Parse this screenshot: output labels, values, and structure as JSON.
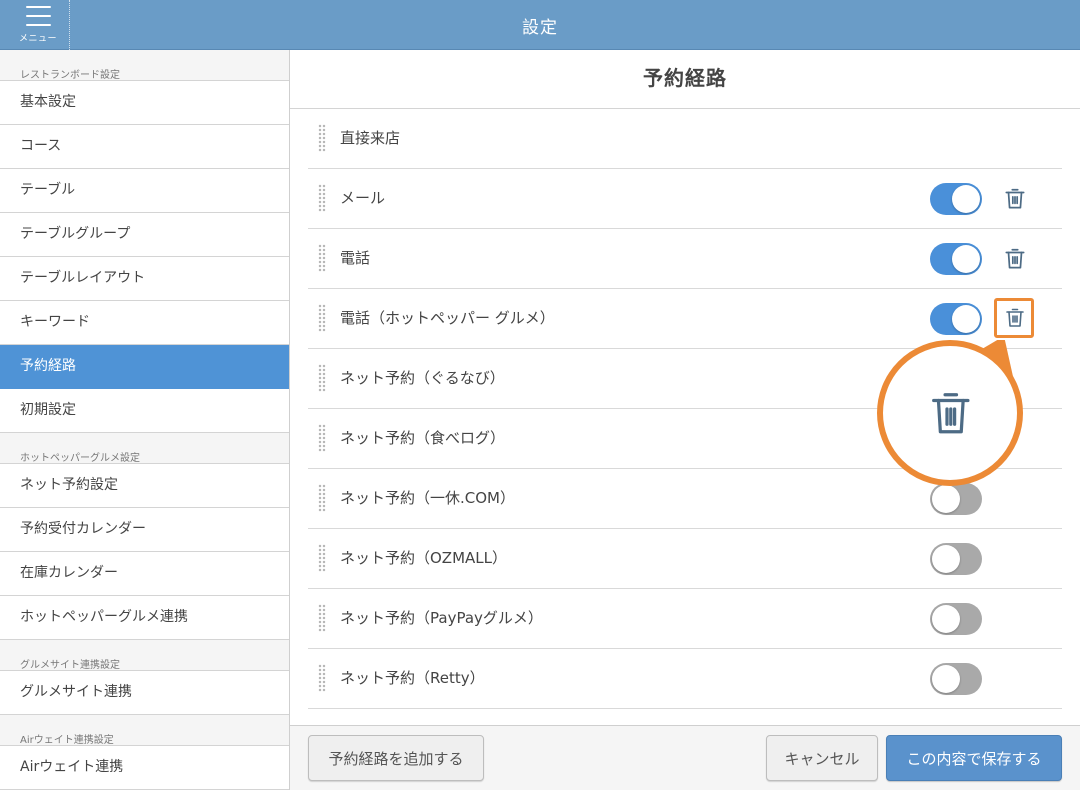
{
  "header": {
    "menu_label": "メニュー",
    "title": "設定"
  },
  "sidebar": {
    "sections": [
      {
        "title": "レストランボード設定",
        "items": [
          "基本設定",
          "コース",
          "テーブル",
          "テーブルグループ",
          "テーブルレイアウト",
          "キーワード",
          "予約経路",
          "初期設定"
        ]
      },
      {
        "title": "ホットペッパーグルメ設定",
        "items": [
          "ネット予約設定",
          "予約受付カレンダー",
          "在庫カレンダー",
          "ホットペッパーグルメ連携"
        ]
      },
      {
        "title": "グルメサイト連携設定",
        "items": [
          "グルメサイト連携"
        ]
      },
      {
        "title": "Airウェイト連携設定",
        "items": [
          "Airウェイト連携"
        ]
      }
    ],
    "active_item": "予約経路"
  },
  "main": {
    "title": "予約経路",
    "rows": [
      {
        "label": "直接来店",
        "toggle": null,
        "deletable": false
      },
      {
        "label": "メール",
        "toggle": true,
        "deletable": true
      },
      {
        "label": "電話",
        "toggle": true,
        "deletable": true
      },
      {
        "label": "電話（ホットペッパー グルメ）",
        "toggle": true,
        "deletable": true,
        "highlighted": true
      },
      {
        "label": "ネット予約（ぐるなび）",
        "toggle": null,
        "deletable": false
      },
      {
        "label": "ネット予約（食べログ）",
        "toggle": null,
        "deletable": false
      },
      {
        "label": "ネット予約（一休.COM）",
        "toggle": false,
        "deletable": false
      },
      {
        "label": "ネット予約（OZMALL）",
        "toggle": false,
        "deletable": false
      },
      {
        "label": "ネット予約（PayPayグルメ）",
        "toggle": false,
        "deletable": false
      },
      {
        "label": "ネット予約（Retty）",
        "toggle": false,
        "deletable": false
      }
    ]
  },
  "footer": {
    "add_label": "予約経路を追加する",
    "cancel_label": "キャンセル",
    "save_label": "この内容で保存する"
  },
  "colors": {
    "header": "#6a9cc7",
    "active": "#4f93d6",
    "toggle_on": "#4a90d9",
    "toggle_off": "#a9a9a9",
    "highlight": "#ec8a36",
    "trash_icon": "#4d6b85",
    "save_button": "#5a92cc"
  },
  "icons": {
    "menu": "hamburger-icon",
    "drag": "drag-handle-icon",
    "delete": "trash-icon"
  }
}
